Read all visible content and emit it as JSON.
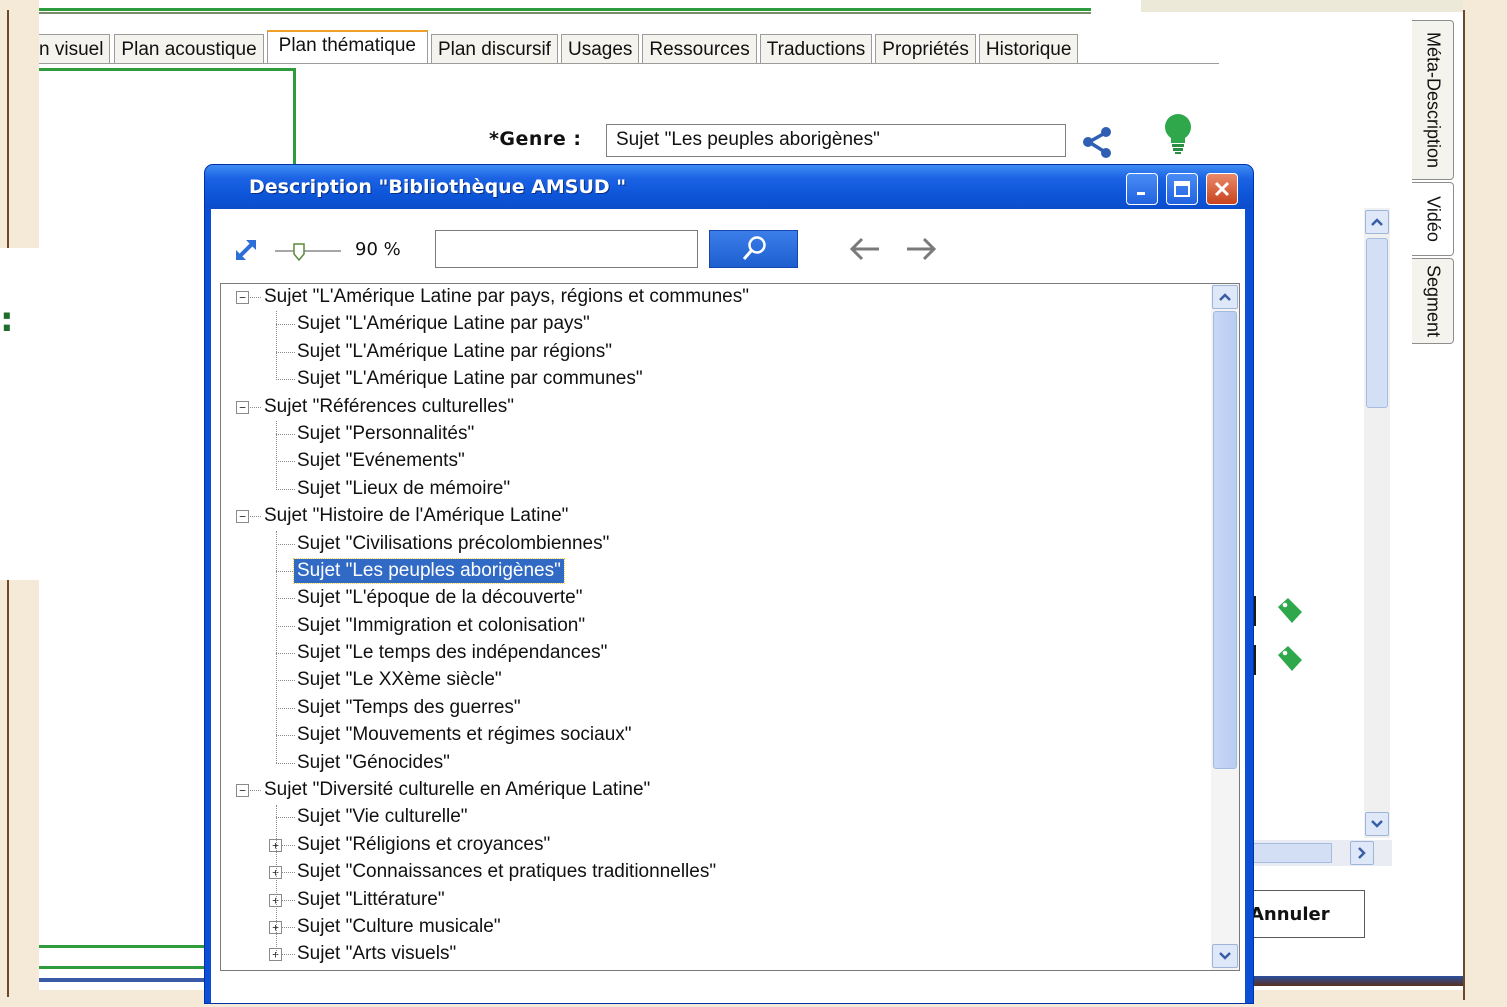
{
  "tabs": [
    {
      "label": "n visuel",
      "active": false
    },
    {
      "label": "Plan acoustique",
      "active": false
    },
    {
      "label": "Plan thématique",
      "active": true
    },
    {
      "label": "Plan discursif",
      "active": false
    },
    {
      "label": "Usages",
      "active": false
    },
    {
      "label": "Ressources",
      "active": false
    },
    {
      "label": "Traductions",
      "active": false
    },
    {
      "label": "Propriétés",
      "active": false
    },
    {
      "label": "Historique",
      "active": false
    }
  ],
  "side_tabs": [
    {
      "label": "Méta-Description",
      "active": false
    },
    {
      "label": "Vidéo",
      "active": true
    },
    {
      "label": "Segment",
      "active": false
    }
  ],
  "form": {
    "genre_label": "*Genre :",
    "genre_value": "Sujet \"Les peuples aborigènes\"",
    "colon_mark": ":",
    "annuler_label": "Annuler"
  },
  "icons": {
    "share": "share-icon",
    "bulb": "lightbulb-icon",
    "tag": "tag-icon",
    "zoom_expand": "expand-icon",
    "search": "magnifier-icon",
    "back": "arrow-left-icon",
    "forward": "arrow-right-icon"
  },
  "colors": {
    "accent_green": "#2e9b3c",
    "dialog_blue": "#0a4fd6",
    "selection_blue": "#316ac5",
    "close_red": "#c9431d",
    "active_tab_top": "#f0a028"
  },
  "dialog": {
    "title": "Description \"Bibliothèque AMSUD \"",
    "zoom_value": "90 %",
    "zoom_level": 0.9,
    "search_value": "",
    "tree": [
      {
        "label": "Sujet \"L'Amérique Latine par pays, régions et communes\"",
        "level": 0,
        "expander": "−"
      },
      {
        "label": "Sujet \"L'Amérique Latine par pays\"",
        "level": 1,
        "expander": ""
      },
      {
        "label": "Sujet \"L'Amérique Latine par régions\"",
        "level": 1,
        "expander": ""
      },
      {
        "label": "Sujet \"L'Amérique Latine par communes\"",
        "level": 1,
        "expander": ""
      },
      {
        "label": "Sujet \"Références culturelles\"",
        "level": 0,
        "expander": "−"
      },
      {
        "label": "Sujet \"Personnalités\"",
        "level": 1,
        "expander": ""
      },
      {
        "label": "Sujet \"Evénements\"",
        "level": 1,
        "expander": ""
      },
      {
        "label": "Sujet \"Lieux de mémoire\"",
        "level": 1,
        "expander": ""
      },
      {
        "label": "Sujet \"Histoire de l'Amérique Latine\"",
        "level": 0,
        "expander": "−"
      },
      {
        "label": "Sujet \"Civilisations précolombiennes\"",
        "level": 1,
        "expander": ""
      },
      {
        "label": "Sujet \"Les peuples aborigènes\"",
        "level": 1,
        "expander": "",
        "selected": true
      },
      {
        "label": "Sujet \"L'époque de la découverte\"",
        "level": 1,
        "expander": ""
      },
      {
        "label": "Sujet \"Immigration et colonisation\"",
        "level": 1,
        "expander": ""
      },
      {
        "label": "Sujet \"Le temps des indépendances\"",
        "level": 1,
        "expander": ""
      },
      {
        "label": "Sujet \"Le XXème siècle\"",
        "level": 1,
        "expander": ""
      },
      {
        "label": "Sujet \"Temps des guerres\"",
        "level": 1,
        "expander": ""
      },
      {
        "label": "Sujet \"Mouvements et régimes sociaux\"",
        "level": 1,
        "expander": ""
      },
      {
        "label": "Sujet \"Génocides\"",
        "level": 1,
        "expander": ""
      },
      {
        "label": "Sujet \"Diversité culturelle en Amérique Latine\"",
        "level": 0,
        "expander": "−"
      },
      {
        "label": "Sujet \"Vie culturelle\"",
        "level": 1,
        "expander": ""
      },
      {
        "label": "Sujet \"Réligions et croyances\"",
        "level": 1,
        "expander": "+"
      },
      {
        "label": "Sujet \"Connaissances et pratiques traditionnelles\"",
        "level": 1,
        "expander": "+"
      },
      {
        "label": "Sujet \"Littérature\"",
        "level": 1,
        "expander": "+"
      },
      {
        "label": "Sujet \"Culture musicale\"",
        "level": 1,
        "expander": "+"
      },
      {
        "label": "Sujet \"Arts visuels\"",
        "level": 1,
        "expander": "+"
      }
    ]
  }
}
